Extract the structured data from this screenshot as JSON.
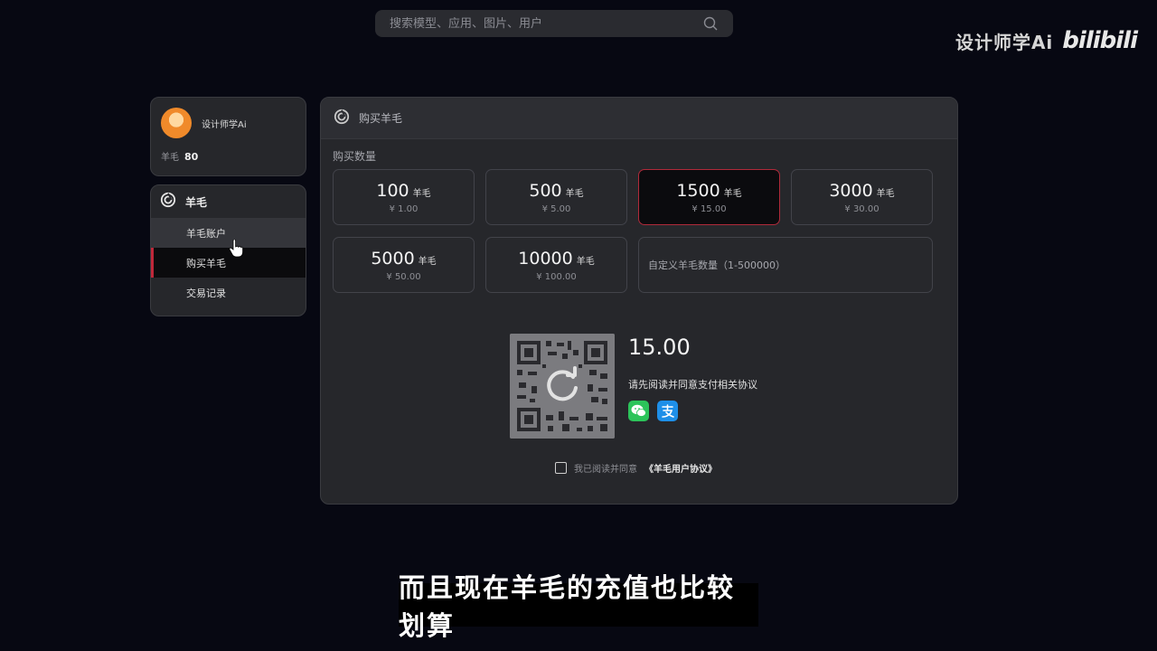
{
  "search": {
    "placeholder": "搜索模型、应用、图片、用户"
  },
  "watermark": {
    "channel": "设计师学Ai",
    "logo_text": "bilibili"
  },
  "user": {
    "name": "设计师学Ai",
    "wool_label": "羊毛",
    "wool_balance": "80"
  },
  "side_menu": {
    "title": "羊毛",
    "items": [
      {
        "label": "羊毛账户"
      },
      {
        "label": "购买羊毛"
      },
      {
        "label": "交易记录"
      }
    ]
  },
  "panel": {
    "title": "购买羊毛",
    "quantity_label": "购买数量",
    "options": [
      {
        "amount": "100",
        "unit": "羊毛",
        "price": "¥ 1.00"
      },
      {
        "amount": "500",
        "unit": "羊毛",
        "price": "¥ 5.00"
      },
      {
        "amount": "1500",
        "unit": "羊毛",
        "price": "¥ 15.00"
      },
      {
        "amount": "3000",
        "unit": "羊毛",
        "price": "¥ 30.00"
      },
      {
        "amount": "5000",
        "unit": "羊毛",
        "price": "¥ 50.00"
      },
      {
        "amount": "10000",
        "unit": "羊毛",
        "price": "¥ 100.00"
      }
    ],
    "custom_placeholder": "自定义羊毛数量（1-500000）",
    "payment": {
      "amount": "15.00",
      "note": "请先阅读并同意支付相关协议"
    },
    "agreement": {
      "prefix": "我已阅读并同意",
      "link": "《羊毛用户协议》"
    }
  },
  "subtitle": "而且现在羊毛的充值也比较划算",
  "colors": {
    "accent": "#c0283a",
    "background": "#070812",
    "panel": "#26272b"
  },
  "icons": [
    "search-icon",
    "spiral-logo-icon",
    "refresh-icon",
    "wechat-pay-icon",
    "alipay-icon",
    "hand-cursor-icon"
  ]
}
